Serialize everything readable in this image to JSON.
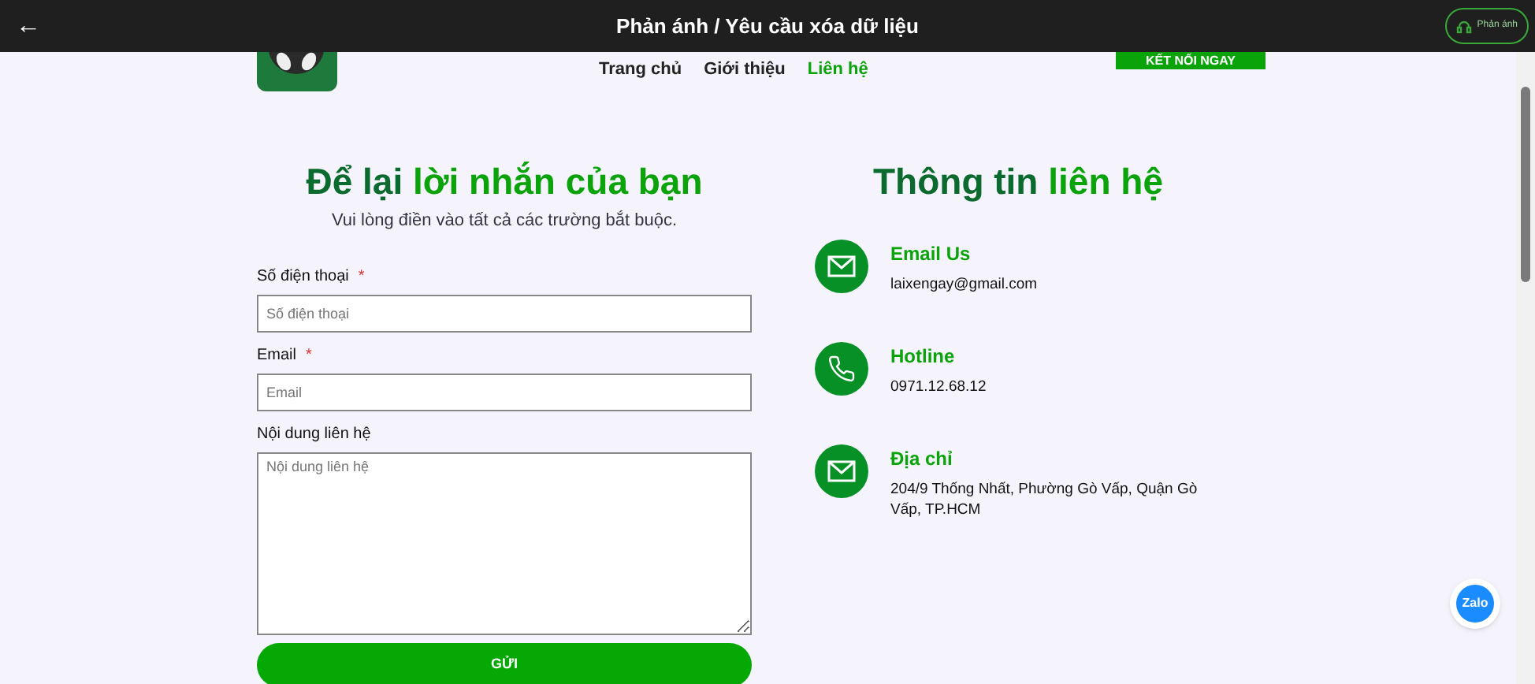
{
  "top_bar": {
    "back": "←",
    "title": "Phản ánh / Yêu cầu xóa dữ liệu",
    "feedback_button": "Phản ánh"
  },
  "nav": {
    "items": [
      {
        "label": "Trang chủ",
        "selected": false
      },
      {
        "label": "Giới thiệu",
        "selected": false
      },
      {
        "label": "Liên hệ",
        "selected": true
      }
    ],
    "cta": "KẾT NỐI NGAY"
  },
  "form": {
    "title_dark": "Để lại",
    "title_green": "lời nhắn của bạn",
    "subtitle": "Vui lòng điền vào tất cả các trường bắt buộc.",
    "fields": [
      {
        "kind": "input",
        "label": "Số điện thoại",
        "required_mark": "*",
        "placeholder": "Số điện thoại"
      },
      {
        "kind": "input",
        "label": "Email",
        "required_mark": "*",
        "placeholder": "Email"
      },
      {
        "kind": "textarea",
        "label": "Nội dung liên hệ",
        "placeholder": "Nội dung liên hệ"
      }
    ],
    "submit": "GỬI"
  },
  "contact": {
    "title_dark": "Thông tin",
    "title_green": "liên hệ",
    "items": [
      {
        "kind": "mail",
        "title": "Email Us",
        "text": "laixengay@gmail.com"
      },
      {
        "kind": "phone",
        "title": "Hotline",
        "text": "0971.12.68.12"
      },
      {
        "kind": "mail",
        "title": "Địa chỉ",
        "text": "204/9 Thống Nhất, Phường Gò Vấp, Quận Gò Vấp, TP.HCM"
      }
    ]
  },
  "chat_widget": {
    "label": "Zalo"
  }
}
